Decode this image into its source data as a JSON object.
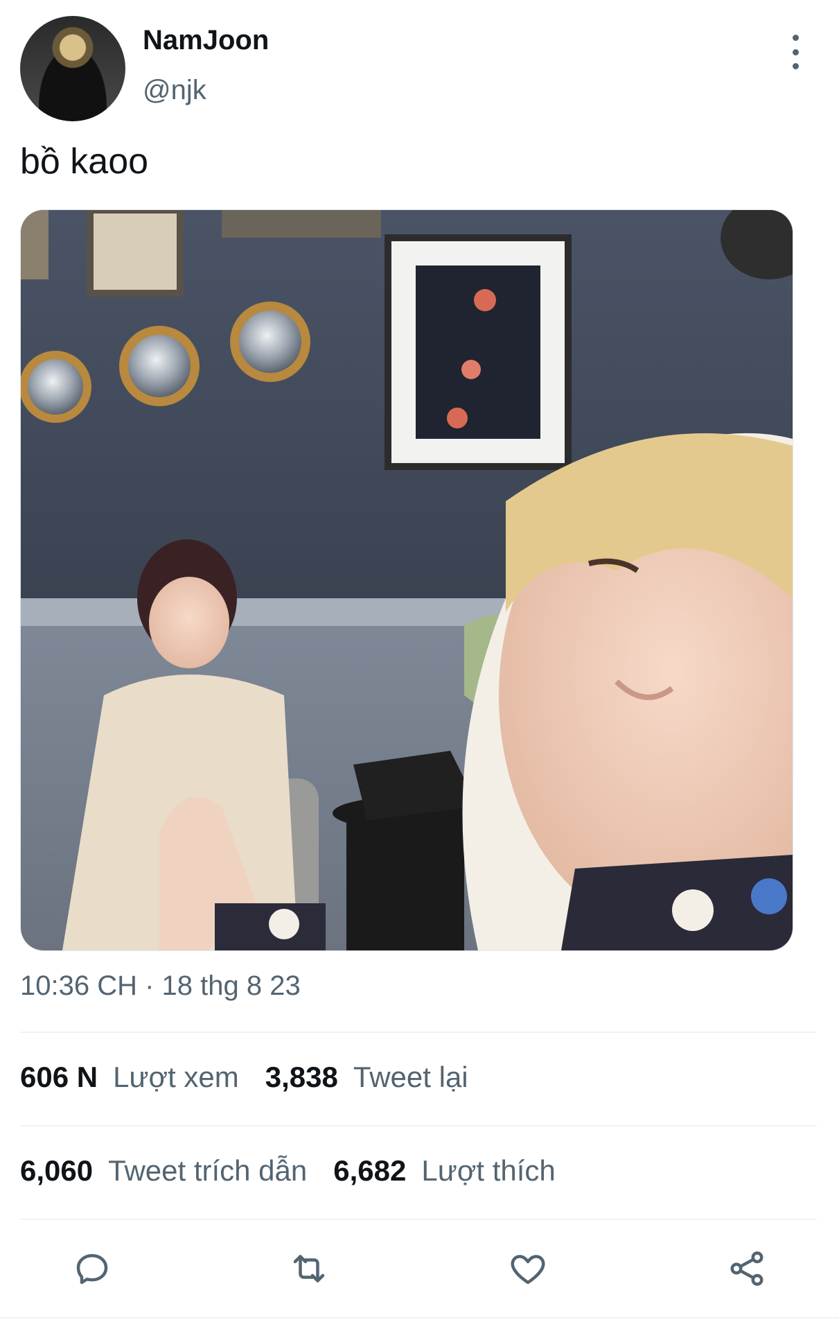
{
  "tweet": {
    "display_name": "NamJoon",
    "handle": "@njk",
    "text": "bồ kaoo",
    "timestamp": "10:36 CH · 18 thg 8 23"
  },
  "stats": {
    "views_count": "606 N",
    "views_label": "Lượt xem",
    "retweets_count": "3,838",
    "retweets_label": "Tweet lại",
    "quotes_count": "6,060",
    "quotes_label": "Tweet trích dẫn",
    "likes_count": "6,682",
    "likes_label": "Lượt thích"
  },
  "icons": {
    "more": "more-vertical-icon",
    "reply": "reply-icon",
    "retweet": "retweet-icon",
    "like": "heart-icon",
    "share": "share-icon"
  },
  "colors": {
    "text_primary": "#0f1419",
    "text_secondary": "#536471",
    "divider": "#eff3f4"
  }
}
